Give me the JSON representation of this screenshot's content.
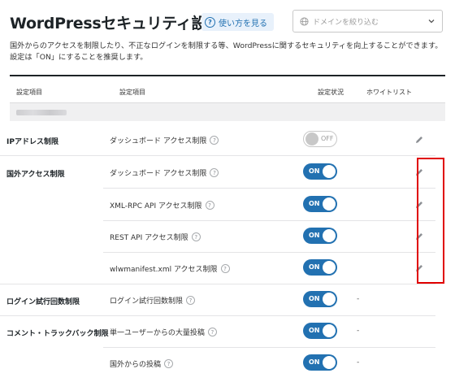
{
  "header": {
    "title": "WordPressセキュリティ設定",
    "help_label": "使い方を見る",
    "help_icon": "question-circle-icon",
    "domain_placeholder": "ドメインを絞り込む"
  },
  "description": {
    "line1": "国外からのアクセスを制限したり、不正なログインを制限する等、WordPressに関するセキュリティを向上することができます。",
    "line2": "設定は「ON」にすることを推奨します。"
  },
  "table": {
    "headers": {
      "item": "設定項目",
      "detail": "設定項目",
      "status": "設定状況",
      "whitelist": "ホワイトリスト"
    },
    "rows": [
      {
        "category": "IPアドレス制限",
        "item": "ダッシュボード アクセス制限",
        "status": "OFF",
        "whitelist_edit": true
      },
      {
        "category": "国外アクセス制限",
        "item": "ダッシュボード アクセス制限",
        "status": "ON",
        "whitelist_edit": true
      },
      {
        "category": "",
        "item": "XML-RPC API アクセス制限",
        "status": "ON",
        "whitelist_edit": true
      },
      {
        "category": "",
        "item": "REST API アクセス制限",
        "status": "ON",
        "whitelist_edit": true
      },
      {
        "category": "",
        "item": "wlwmanifest.xml アクセス制限",
        "status": "ON",
        "whitelist_edit": true
      },
      {
        "category": "ログイン試行回数制限",
        "item": "ログイン試行回数制限",
        "status": "ON",
        "whitelist": "-"
      },
      {
        "category": "コメント・トラックバック制限",
        "item": "単一ユーザーからの大量投稿",
        "status": "ON",
        "whitelist": "-"
      },
      {
        "category": "",
        "item": "国外からの投稿",
        "status": "ON",
        "whitelist": "-"
      }
    ]
  },
  "colors": {
    "accent": "#2271b1",
    "highlight": "#e00000"
  }
}
